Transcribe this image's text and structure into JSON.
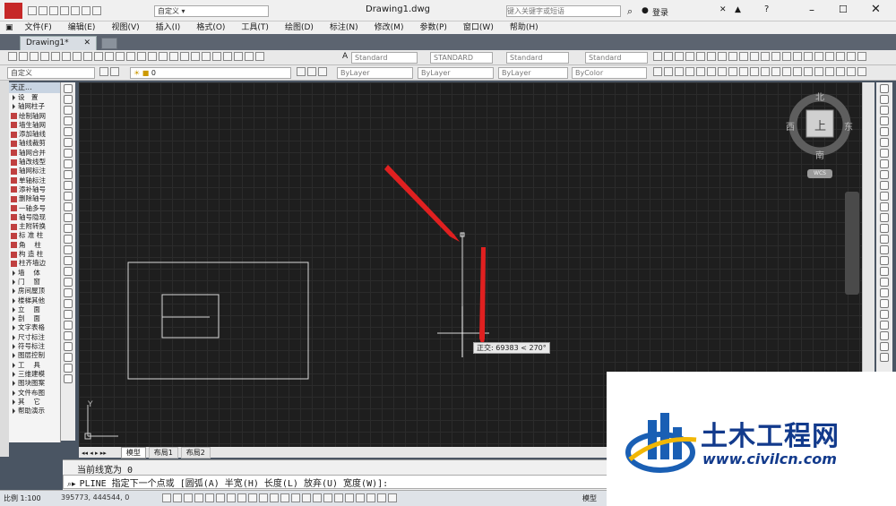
{
  "title_bar": {
    "workspace": "自定义",
    "file": "Drawing1.dwg",
    "search_placeholder": "键入关键字或短语",
    "login": "登录"
  },
  "menu": [
    "文件(F)",
    "编辑(E)",
    "视图(V)",
    "插入(I)",
    "格式(O)",
    "工具(T)",
    "绘图(D)",
    "标注(N)",
    "修改(M)",
    "参数(P)",
    "窗口(W)",
    "帮助(H)"
  ],
  "doc_tab": "Drawing1*",
  "styles": [
    "Standard",
    "STANDARD",
    "Standard",
    "Standard"
  ],
  "layer_name": "0",
  "layer_combo": "自定义",
  "props": [
    "ByLayer",
    "ByLayer",
    "ByLayer",
    "ByColor"
  ],
  "palette": {
    "header": "天正...",
    "items": [
      "设　置",
      "轴网柱子",
      "绘制轴网",
      "墙生轴网",
      "添加轴线",
      "轴线裁剪",
      "轴网合并",
      "轴改线型",
      "轴网标注",
      "单轴标注",
      "添补轴号",
      "删除轴号",
      "一轴多号",
      "轴号隐现",
      "主附转换",
      "标 准 柱",
      "角　 柱",
      "构 造 柱",
      "柱齐墙边",
      "墙　 体",
      "门　 窗",
      "房间屋顶",
      "楼梯其他",
      "立　 面",
      "剖　 面",
      "文字表格",
      "尺寸标注",
      "符号标注",
      "图层控制",
      "工　 具",
      "三维建模",
      "图块图案",
      "文件布图",
      "其　 它",
      "帮助演示"
    ]
  },
  "viewcube": {
    "north": "北",
    "south": "南",
    "west": "西",
    "east": "东",
    "face": "上",
    "wcs": "WCS"
  },
  "tooltip": "正交: 69383 < 270°",
  "ucs": {
    "y": "Y"
  },
  "layout_tabs": [
    "模型",
    "布局1",
    "布局2"
  ],
  "command": {
    "line1": "当前线宽为 0",
    "line2": "PLINE 指定下一个点或 [圆弧(A) 半宽(H) 长度(L) 放弃(U) 宽度(W)]:"
  },
  "status": {
    "scale": "比例 1:100",
    "coords": "395773, 444544, 0",
    "model": "模型"
  },
  "watermark": {
    "name": "土木工程网",
    "url": "www.civilcn.com"
  }
}
